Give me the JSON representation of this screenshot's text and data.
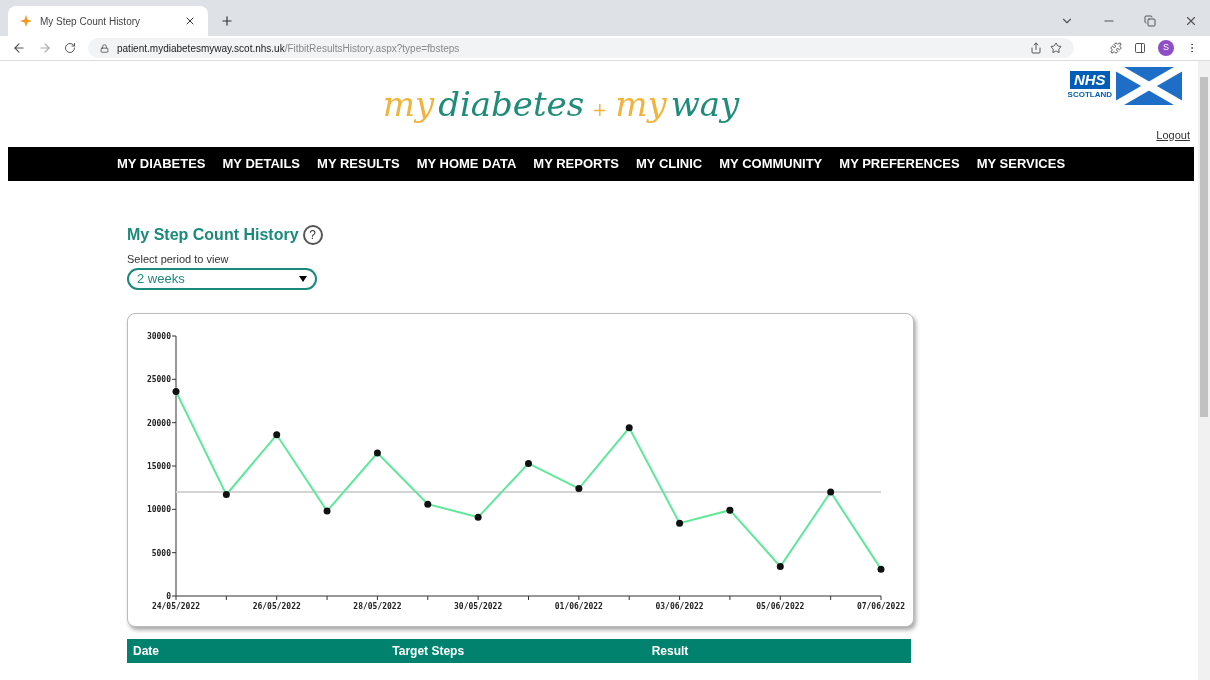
{
  "browser": {
    "tab_title": "My Step Count History",
    "url_host": "patient.mydiabetesmyway.scot.nhs.uk",
    "url_path": "/FitbitResultsHistory.aspx?type=fbsteps",
    "profile_initial": "S"
  },
  "header": {
    "logo": [
      {
        "text": "my",
        "kind": "accent"
      },
      {
        "text": "diabetes",
        "kind": "main"
      },
      {
        "text": "+",
        "kind": "accent"
      },
      {
        "text": "my",
        "kind": "accent"
      },
      {
        "text": "way",
        "kind": "main"
      }
    ],
    "nhs": {
      "title": "NHS",
      "subtitle": "SCOTLAND"
    },
    "logout": "Logout"
  },
  "nav": [
    "MY DIABETES",
    "MY DETAILS",
    "MY RESULTS",
    "MY HOME DATA",
    "MY REPORTS",
    "MY CLINIC",
    "MY COMMUNITY",
    "MY PREFERENCES",
    "MY SERVICES"
  ],
  "page": {
    "title": "My Step Count History",
    "help": "?",
    "period_label": "Select period to view",
    "period_value": "2 weeks",
    "chart_data": {
      "type": "line",
      "categories": [
        "24/05/2022",
        null,
        "26/05/2022",
        null,
        "28/05/2022",
        null,
        "30/05/2022",
        null,
        "01/06/2022",
        null,
        "03/06/2022",
        null,
        "05/06/2022",
        null,
        "07/06/2022"
      ],
      "series": [
        {
          "color": "#d4d4d4",
          "values": [
            12000,
            12000,
            12000,
            12000,
            12000,
            12000,
            12000,
            12000,
            12000,
            12000,
            12000,
            12000,
            12000,
            12000,
            12000
          ]
        },
        {
          "color": "#5ee89a",
          "marker": "o",
          "values": [
            23600,
            11700,
            18600,
            9800,
            16500,
            10600,
            9100,
            15300,
            12400,
            19400,
            8400,
            9900,
            3400,
            12000,
            3100
          ]
        }
      ],
      "ylim": [
        0,
        30000
      ],
      "yticks": [
        0,
        5000,
        10000,
        15000,
        20000,
        25000,
        30000
      ]
    },
    "table": {
      "columns": [
        "Date",
        "Target Steps",
        "Result"
      ]
    }
  }
}
